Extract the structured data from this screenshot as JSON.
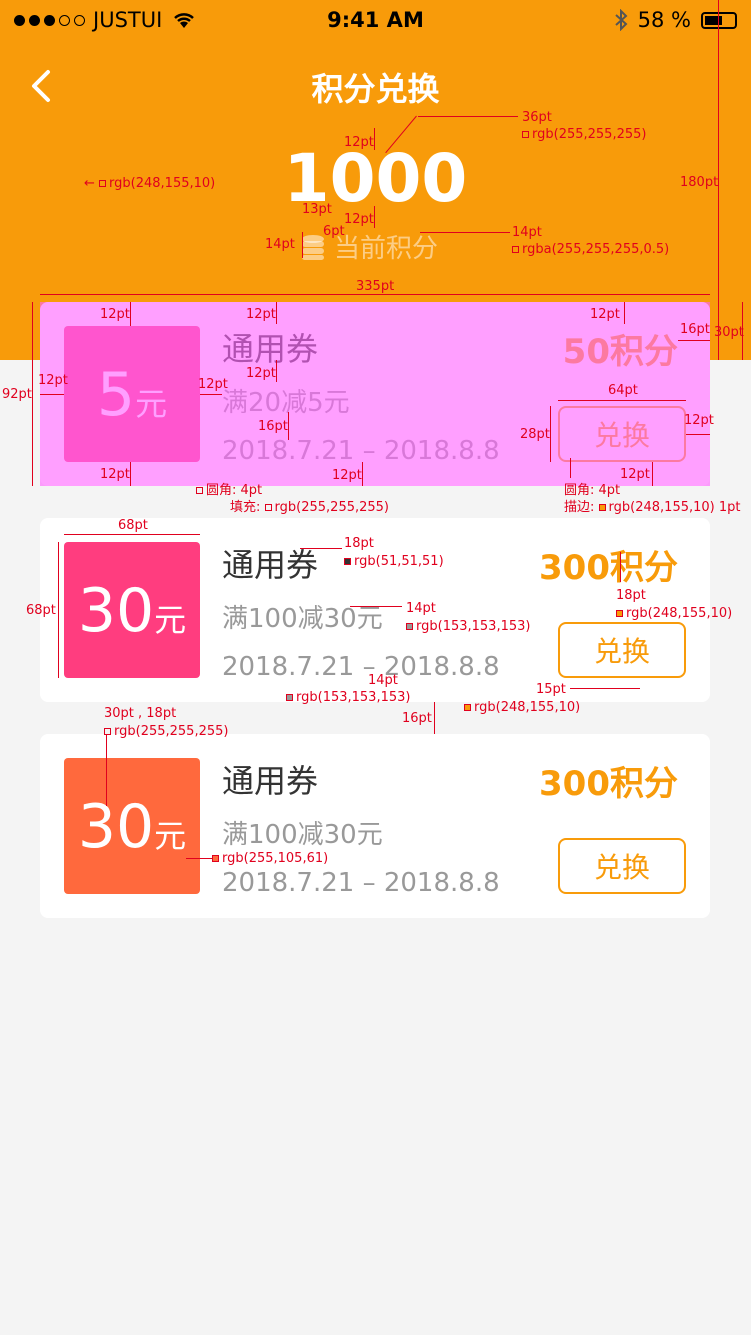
{
  "status_bar": {
    "carrier": "JUSTUI",
    "time": "9:41 AM",
    "battery": "58 %"
  },
  "header": {
    "title": "积分兑换",
    "points": "1000",
    "points_label": "当前积分"
  },
  "cards": [
    {
      "title": "通用券",
      "amount": "5",
      "unit": "元",
      "desc": "满20减5元",
      "date": "2018.7.21 – 2018.8.8",
      "cost": "50积分",
      "button": "兑换",
      "badge_color": "#ff3d7f"
    },
    {
      "title": "通用券",
      "amount": "30",
      "unit": "元",
      "desc": "满100减30元",
      "date": "2018.7.21 – 2018.8.8",
      "cost": "300积分",
      "button": "兑换",
      "badge_color": "#ff3d7f"
    },
    {
      "title": "通用券",
      "amount": "30",
      "unit": "元",
      "desc": "满100减30元",
      "date": "2018.7.21 – 2018.8.8",
      "cost": "300积分",
      "button": "兑换",
      "badge_color": "#ff693d"
    }
  ],
  "annotations": {
    "a1": "36pt",
    "a2": "rgb(255,255,255)",
    "a3": "12pt",
    "a4": "rgb(248,155,10)",
    "a5": "180pt",
    "a6": "13pt",
    "a7": "12pt",
    "a8": "6pt",
    "a9": "14pt",
    "a10": "rgba(255,255,255,0.5)",
    "a11": "14pt",
    "a12": "335pt",
    "a13": "12pt",
    "a14": "12pt",
    "a15": "12pt",
    "a16": "16pt",
    "a17": "30pt",
    "a18": "92pt",
    "a19": "12pt",
    "a20": "12pt",
    "a21": "12pt",
    "a22": "64pt",
    "a23": "12pt",
    "a24": "16pt",
    "a25": "28pt",
    "a26": "12pt",
    "a27": "12pt",
    "a28": "12pt",
    "a29": "圆角: 4pt",
    "a30": "填充:",
    "a31": "rgb(255,255,255)",
    "a32": "圆角: 4pt",
    "a33": "描边:",
    "a34": "rgb(248,155,10)",
    "a35": "1pt",
    "a36": "68pt",
    "a37": "18pt",
    "a38": "rgb(51,51,51)",
    "a39": "68pt",
    "a40": "14pt",
    "a41": "rgb(153,153,153)",
    "a42": "18pt",
    "a43": "rgb(248,155,10)",
    "a44": "14pt",
    "a45": "rgb(153,153,153)",
    "a46": "15pt",
    "a47": "rgb(248,155,10)",
    "a48": "16pt",
    "a49": "30pt , 18pt",
    "a50": "rgb(255,255,255)",
    "a51": "rgb(255,105,61)"
  }
}
